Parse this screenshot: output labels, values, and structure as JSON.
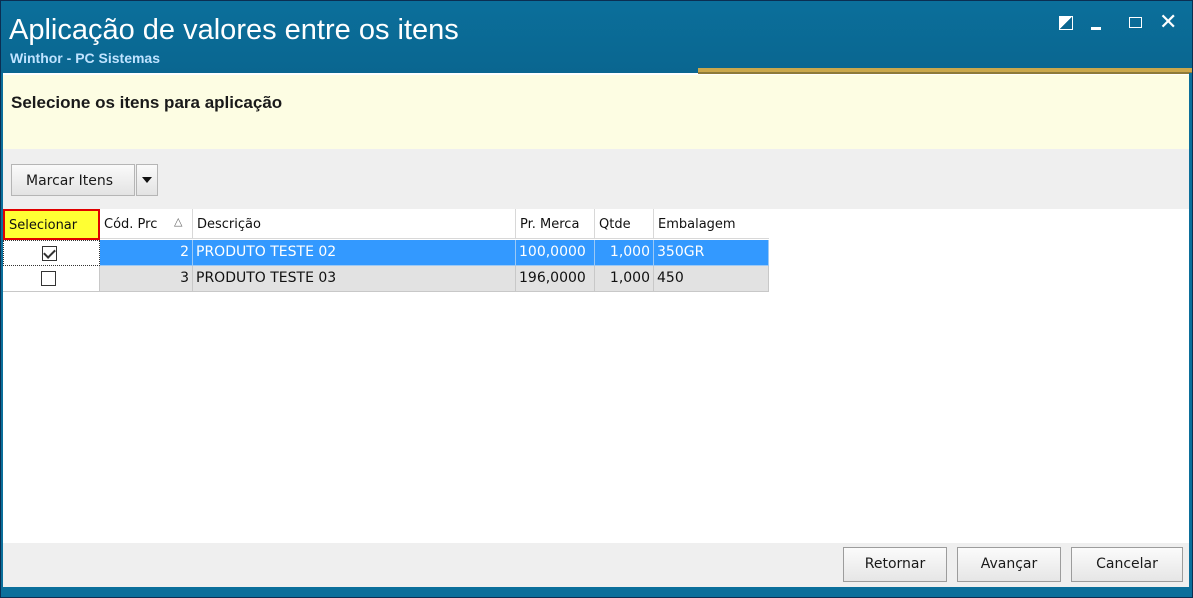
{
  "window": {
    "title": "Aplicação de valores entre os itens",
    "subtitle": "Winthor - PC Sistemas",
    "close_glyph": "✕"
  },
  "header": {
    "text": "Selecione os itens para aplicação"
  },
  "toolbar": {
    "mark_items_label": "Marcar Itens"
  },
  "grid": {
    "columns": [
      "Selecionar",
      "Cód. Prc",
      "Descrição",
      "Pr. Merca",
      "Qtde",
      "Embalagem"
    ],
    "sort_indicator": "△",
    "rows": [
      {
        "selected": true,
        "cod": "2",
        "descricao": "PRODUTO TESTE 02",
        "preco": "100,0000",
        "qtde": "1,000",
        "embalagem": "350GR"
      },
      {
        "selected": false,
        "cod": "3",
        "descricao": "PRODUTO TESTE 03",
        "preco": "196,0000",
        "qtde": "1,000",
        "embalagem": "450"
      }
    ]
  },
  "footer": {
    "retornar_label": "Retornar",
    "avancar_label": "Avançar",
    "cancelar_label": "Cancelar"
  },
  "colors": {
    "titlebar": "#0b6f9b",
    "header_bg": "#fdfde3",
    "selected_row": "#3399ff",
    "highlight_header": "#ffff33",
    "highlight_border": "#e00000"
  },
  "icons": [
    "restore-icon",
    "minimize-icon",
    "maximize-icon",
    "close-icon",
    "dropdown-arrow-icon",
    "sort-ascending-icon",
    "checkbox-checked-icon",
    "checkbox-unchecked-icon"
  ]
}
